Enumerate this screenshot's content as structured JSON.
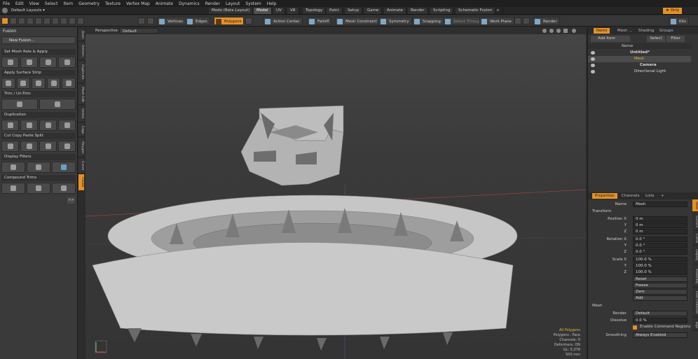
{
  "menu": [
    "File",
    "Edit",
    "View",
    "Select",
    "Item",
    "Geometry",
    "Texture",
    "Vertex Map",
    "Animate",
    "Dynamics",
    "Render",
    "Layout",
    "System",
    "Help"
  ],
  "layout_selector": "Default Layouts ▾",
  "layout_tabs": [
    "Modo (Beta Layout)",
    "Model",
    "UV",
    "VR",
    "Topology",
    "Paint",
    "Setup",
    "Game",
    "Animate",
    "Render",
    "Scripting",
    "Schematic Fusion",
    "+"
  ],
  "active_layout_tab": "Model",
  "only_label": "★ Only",
  "toolbar": {
    "vertices": "Vertices",
    "edges": "Edges",
    "polygons": "Polygons",
    "action_center": "Action Center",
    "falloff": "Falloff",
    "mesh_constraint": "Mesh Constraint",
    "symmetry": "Symmetry",
    "snapping": "Snapping",
    "select_through": "Select Through",
    "work_plane": "Work Plane",
    "render": "Render",
    "kits": "Kits"
  },
  "left_panel": {
    "title": "Fusion",
    "new_fusion": "New Fusion...",
    "sections": [
      "Set Mesh Role & Apply",
      "Apply Surface Strip",
      "Trim / Un-Trim",
      "Duplication",
      "Cut Copy Paste Split",
      "Display Filters",
      "Compound Trims"
    ],
    "more": ">>"
  },
  "left_vtabs": [
    "Basic",
    "Deform",
    "Duplicate",
    "Mesh Edit",
    "Vertex",
    "Edge",
    "Polygon",
    "Curve",
    "Fusion"
  ],
  "viewport": {
    "view_mode": "Perspective",
    "shading": "Default",
    "stats": [
      "All Polygons",
      "Polygons : Face",
      "Channels: 0",
      "Deformers: ON",
      "GL: 5,078",
      "500 mm"
    ]
  },
  "items_panel": {
    "tabs": [
      "Items",
      "Mesh ...",
      "Shading",
      "Groups"
    ],
    "add_item": "Add Item",
    "select": "Select",
    "filter": "Filter",
    "name_header": "Name",
    "tree": [
      "Untitled*",
      "Mesh",
      "Camera",
      "Directional Light"
    ]
  },
  "properties_panel": {
    "tabs": [
      "Properties",
      "Channels",
      "Lists",
      "+"
    ],
    "name_label": "Name",
    "name_value": "Mesh",
    "transform_header": "Transform",
    "rows": [
      {
        "label": "Position X",
        "value": "0 m"
      },
      {
        "label": "Y",
        "value": "0 m"
      },
      {
        "label": "Z",
        "value": "0 m"
      },
      {
        "label": "Rotation X",
        "value": "0.0 °"
      },
      {
        "label": "Y",
        "value": "0.0 °"
      },
      {
        "label": "Z",
        "value": "0.0 °"
      },
      {
        "label": "Scale X",
        "value": "100.0 %"
      },
      {
        "label": "Y",
        "value": "100.0 %"
      },
      {
        "label": "Z",
        "value": "100.0 %"
      }
    ],
    "actions": [
      "Reset",
      "Freeze",
      "Zero",
      "Add"
    ],
    "mesh_header": "Mesh",
    "render_label": "Render",
    "render_value": "Default",
    "dissolve_label": "Dissolve",
    "dissolve_value": "0.0 %",
    "command_regions": "Enable Command Regions",
    "smoothing_label": "Smoothing",
    "smoothing_value": "Always Enabled"
  },
  "right_vtabs": [
    "Mesh",
    "Surface",
    "Curve",
    "Display",
    "Assembly",
    "User Channels",
    "Tags"
  ]
}
